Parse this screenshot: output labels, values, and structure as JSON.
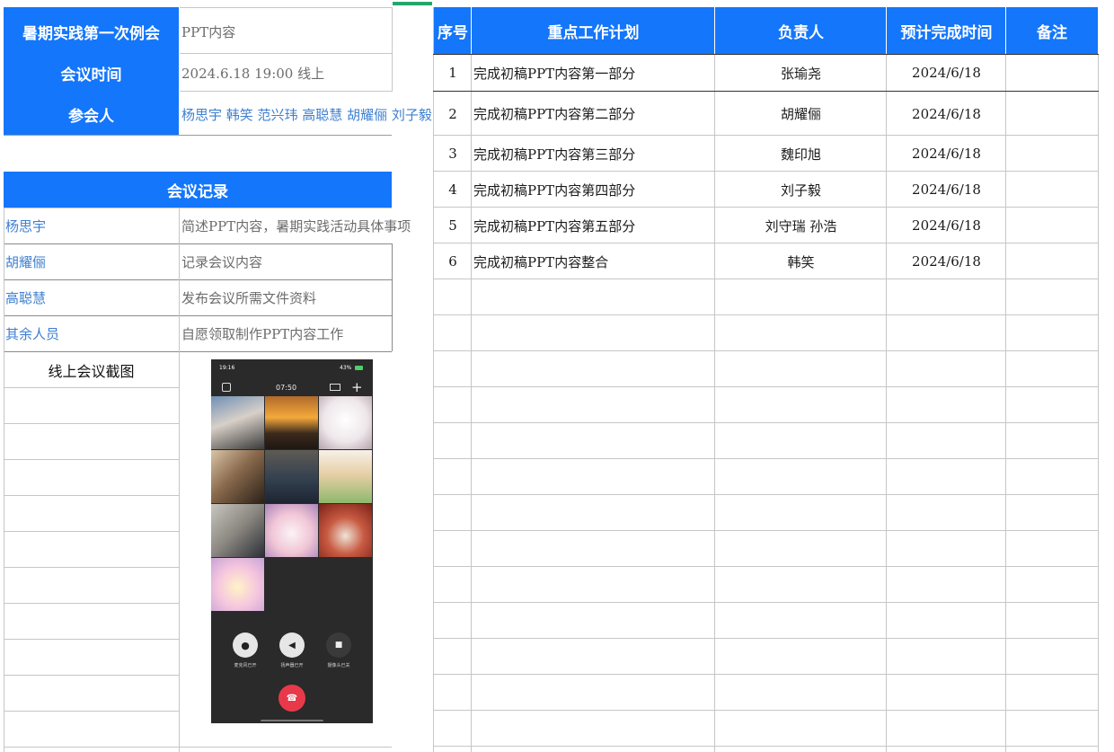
{
  "meeting": {
    "title_label": "暑期实践第一次例会",
    "title_value": "PPT内容",
    "time_label": "会议时间",
    "time_value": "2024.6.18 19:00 线上",
    "attendees_label": "参会人",
    "attendees_value": "杨思宇 韩笑 范兴玮 高聪慧 胡耀俪 刘子毅"
  },
  "record": {
    "header": "会议记录",
    "rows": [
      {
        "name": "杨思宇",
        "task": "简述PPT内容，暑期实践活动具体事项"
      },
      {
        "name": "胡耀俪",
        "task": "记录会议内容"
      },
      {
        "name": "高聪慧",
        "task": "发布会议所需文件资料"
      },
      {
        "name": "其余人员",
        "task": "自愿领取制作PPT内容工作"
      }
    ],
    "screenshot_label": "线上会议截图"
  },
  "plan": {
    "headers": [
      "序号",
      "重点工作计划",
      "负责人",
      "预计完成时间",
      "备注"
    ],
    "rows": [
      [
        "1",
        "完成初稿PPT内容第一部分",
        "张瑜尧",
        "2024/6/18",
        ""
      ],
      [
        "2",
        "完成初稿PPT内容第二部分",
        "胡耀俪",
        "2024/6/18",
        ""
      ],
      [
        "3",
        "完成初稿PPT内容第三部分",
        "魏印旭",
        "2024/6/18",
        ""
      ],
      [
        "4",
        "完成初稿PPT内容第四部分",
        "刘子毅",
        "2024/6/18",
        ""
      ],
      [
        "5",
        "完成初稿PPT内容第五部分",
        "刘守瑞 孙浩",
        "2024/6/18",
        ""
      ],
      [
        "6",
        "完成初稿PPT内容整合",
        "韩笑",
        "2024/6/18",
        ""
      ]
    ]
  },
  "phone": {
    "status_time": "19:16",
    "status_right": "43%",
    "call_duration": "07:50",
    "controls": [
      "麦克风已开",
      "扬声器已开",
      "摄像头已关"
    ]
  },
  "colors": {
    "header_blue": "#1476fa",
    "link_blue": "#3e7fd0",
    "hangup_red": "#e8394b"
  }
}
